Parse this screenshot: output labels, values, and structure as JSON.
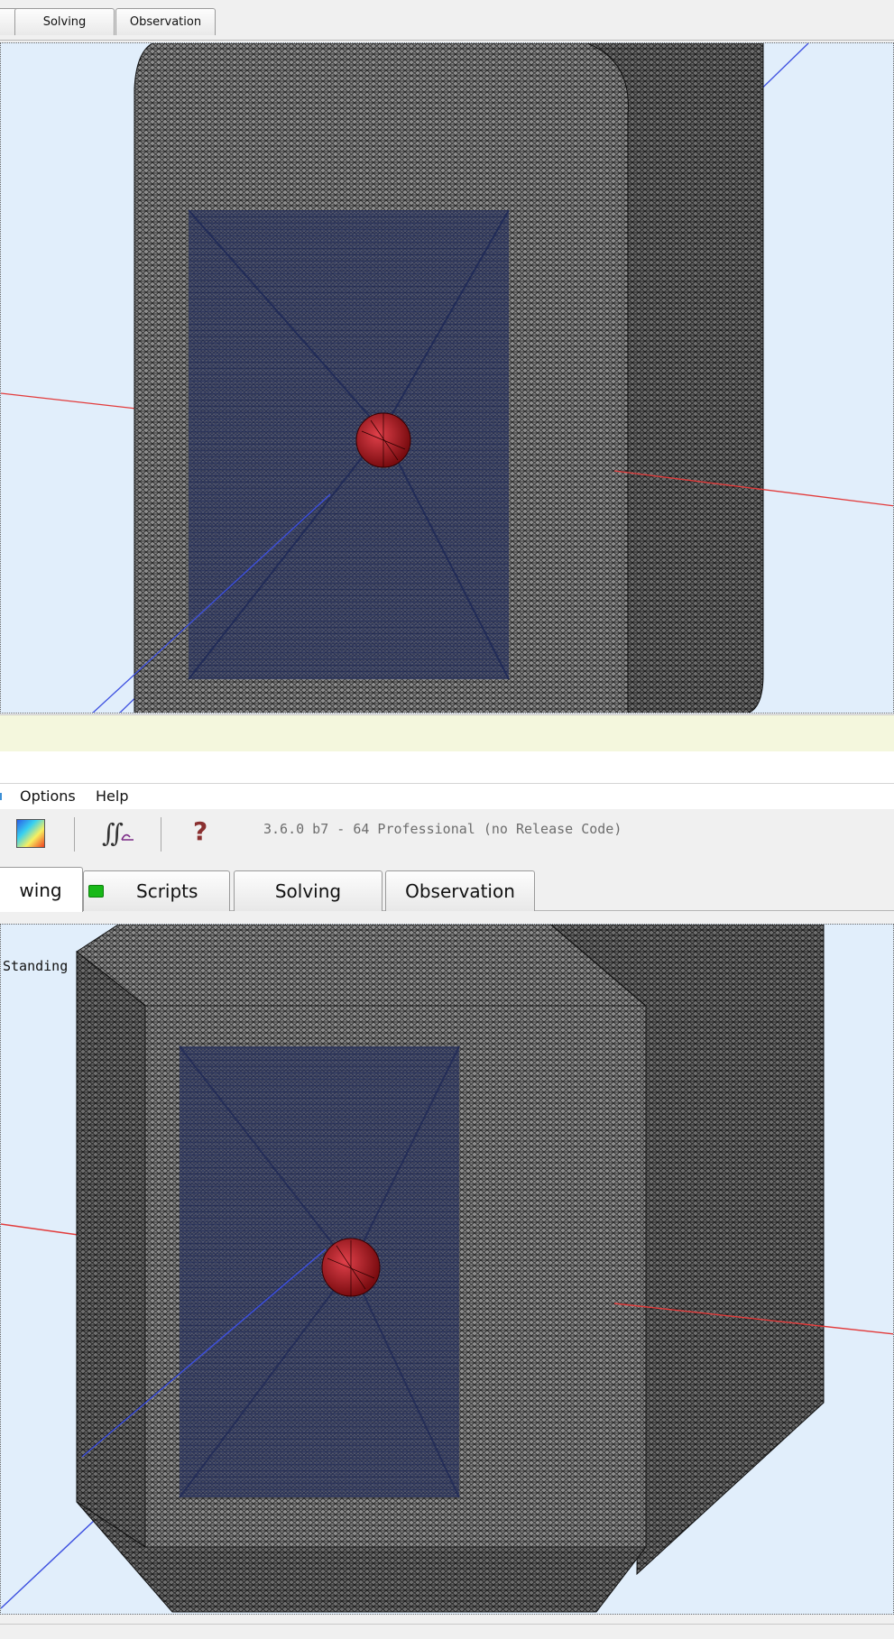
{
  "top_window": {
    "tabs": [
      {
        "label": "Solving"
      },
      {
        "label": "Observation"
      }
    ]
  },
  "bottom_window": {
    "menu": [
      {
        "label": "Options"
      },
      {
        "label": "Help"
      }
    ],
    "toolbar": {
      "icons": [
        "color-map-icon",
        "integral-icon",
        "help-icon"
      ],
      "version": "3.6.0 b7 - 64 Professional (no Release Code)"
    },
    "tabs": [
      {
        "label": "wing",
        "active": true
      },
      {
        "label": "Scripts",
        "status_icon": "green-led-icon"
      },
      {
        "label": "Solving"
      },
      {
        "label": "Observation"
      }
    ],
    "viewport_label": "Standing"
  },
  "colors": {
    "viewport_bg": "#e1eefb",
    "mesh_fill": "#8a8a8a",
    "mesh_line": "#111111",
    "inner_mesh": "#1f2f6a",
    "sphere": "#b0161c",
    "x_axis": "#e23b3b",
    "z_axis": "#3c4fe0",
    "scripts_led": "#18b818"
  }
}
